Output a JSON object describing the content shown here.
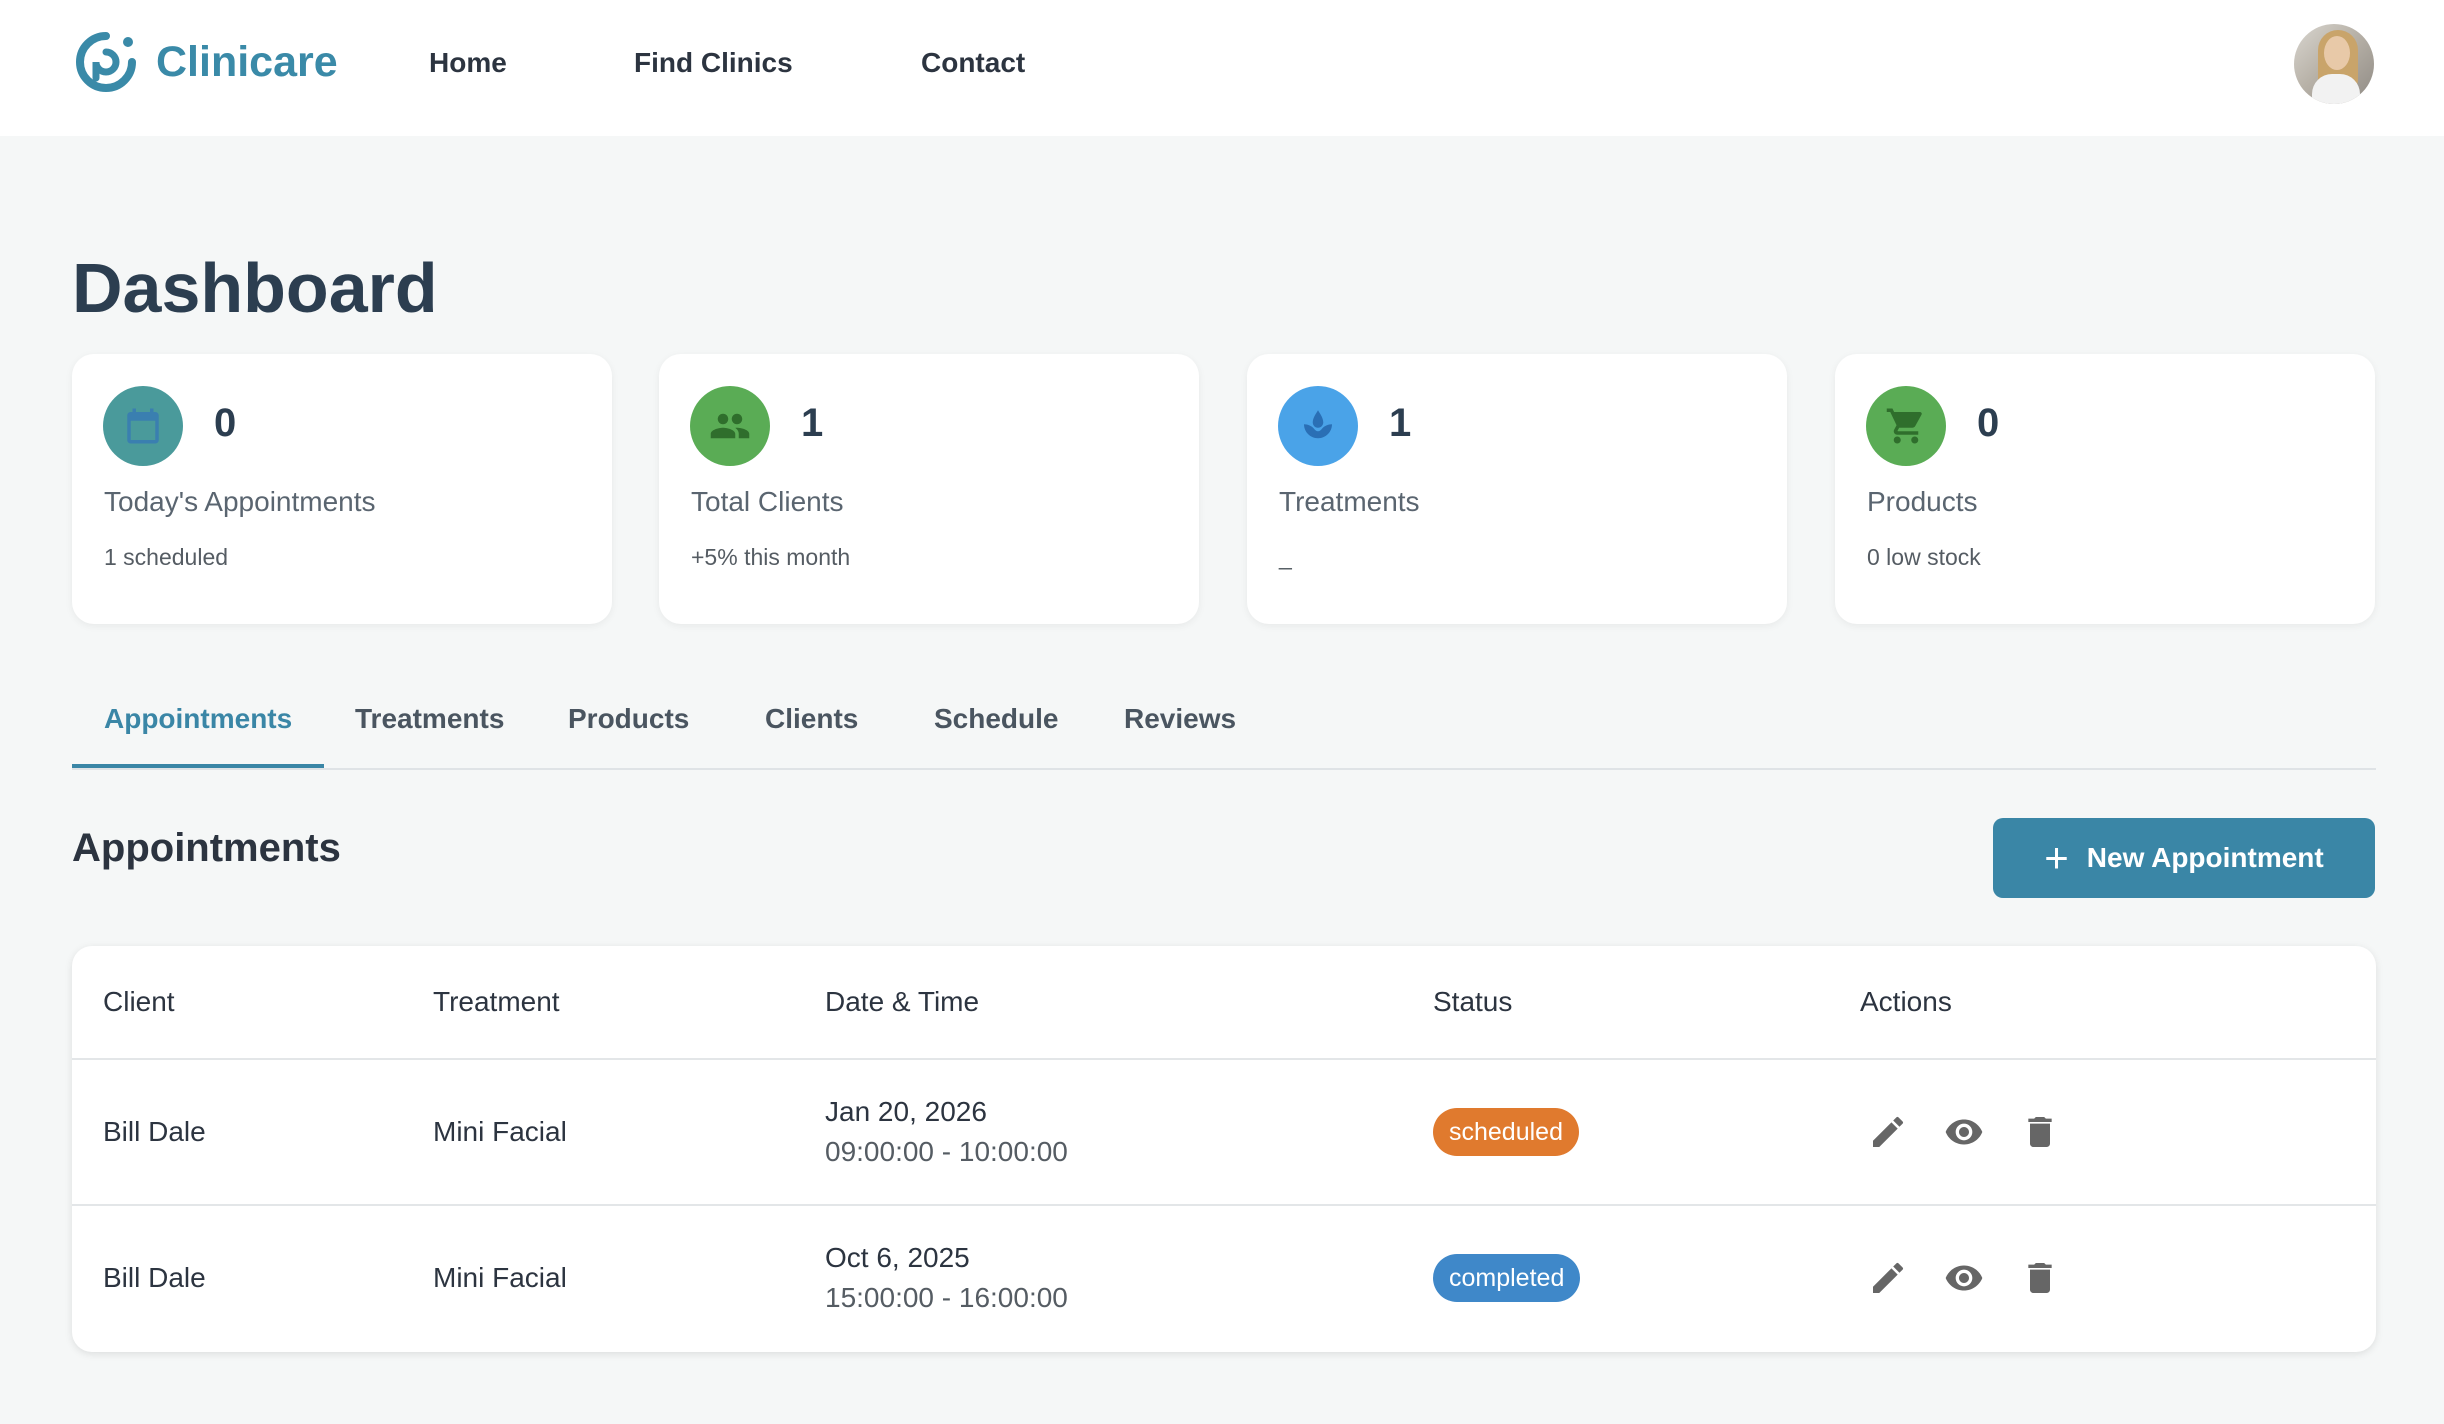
{
  "app": {
    "name": "Clinicare"
  },
  "nav": {
    "links": [
      "Home",
      "Find Clinics",
      "Contact"
    ]
  },
  "page": {
    "title": "Dashboard"
  },
  "stats": [
    {
      "value": "0",
      "label": "Today's Appointments",
      "sub": "1 scheduled",
      "icon": "calendar-icon",
      "color": "#4a9a9b"
    },
    {
      "value": "1",
      "label": "Total Clients",
      "sub": "+5% this month",
      "icon": "people-icon",
      "color": "#5aac55"
    },
    {
      "value": "1",
      "label": "Treatments",
      "sub": "_",
      "icon": "spa-icon",
      "color": "#4aa3e8"
    },
    {
      "value": "0",
      "label": "Products",
      "sub": "0 low stock",
      "icon": "cart-icon",
      "color": "#5aac55"
    }
  ],
  "tabs": [
    "Appointments",
    "Treatments",
    "Products",
    "Clients",
    "Schedule",
    "Reviews"
  ],
  "active_tab": "Appointments",
  "section": {
    "title": "Appointments",
    "new_button": "New Appointment"
  },
  "table": {
    "headers": [
      "Client",
      "Treatment",
      "Date & Time",
      "Status",
      "Actions"
    ],
    "rows": [
      {
        "client": "Bill Dale",
        "treatment": "Mini Facial",
        "date": "Jan 20, 2026",
        "time": "09:00:00 - 10:00:00",
        "status": "scheduled",
        "status_color": "#e07a2e"
      },
      {
        "client": "Bill Dale",
        "treatment": "Mini Facial",
        "date": "Oct 6, 2025",
        "time": "15:00:00 - 16:00:00",
        "status": "completed",
        "status_color": "#3f88c9"
      }
    ]
  },
  "colors": {
    "accent": "#3a86a6",
    "brand": "#3a8aa8"
  }
}
